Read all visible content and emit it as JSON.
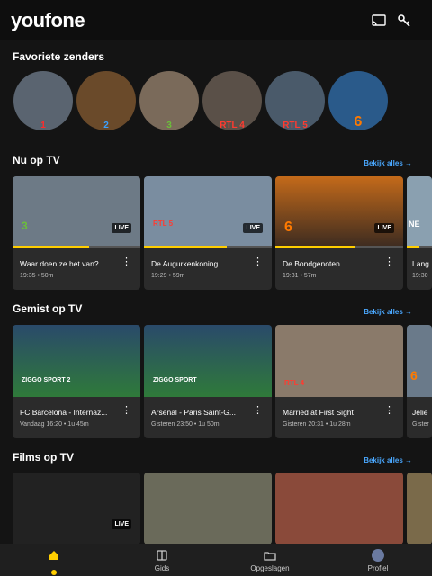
{
  "app": {
    "logo": "youfone"
  },
  "icons": {
    "cast": "cast-icon",
    "key": "key-icon"
  },
  "sections": {
    "favorites": {
      "title": "Favoriete zenders"
    },
    "now": {
      "title": "Nu op TV",
      "see_all": "Bekijk alles →"
    },
    "missed": {
      "title": "Gemist op TV",
      "see_all": "Bekijk alles →"
    },
    "films": {
      "title": "Films op TV",
      "see_all": "Bekijk alles →"
    }
  },
  "channels": [
    {
      "badge": "1",
      "color": "#ff2b2b"
    },
    {
      "badge": "2",
      "color": "#3aa0ff"
    },
    {
      "badge": "3",
      "color": "#6bbf3a"
    },
    {
      "badge": "RTL 4",
      "color": "#ff3b30"
    },
    {
      "badge": "RTL 5",
      "color": "#ff3b30"
    },
    {
      "badge": "6",
      "color": "#ff7a00"
    }
  ],
  "now_cards": [
    {
      "title": "Waar doen ze het van?",
      "meta": "19:35 • 50m",
      "live": "LIVE",
      "logo": "3",
      "progress": 0.6
    },
    {
      "title": "De Augurkenkoning",
      "meta": "19:29 • 59m",
      "live": "LIVE",
      "logo": "RTL 5",
      "progress": 0.65
    },
    {
      "title": "De Bondgenoten",
      "meta": "19:31 • 57m",
      "live": "LIVE",
      "logo": "6",
      "progress": 0.62
    },
    {
      "title": "Lang",
      "meta": "19:30",
      "live": "",
      "logo": "NE",
      "progress": 0.5
    }
  ],
  "missed_cards": [
    {
      "title": "FC Barcelona - Internaz...",
      "meta": "Vandaag 16:20 • 1u 45m",
      "logo": "ZIGGO SPORT 2"
    },
    {
      "title": "Arsenal - Paris Saint-G...",
      "meta": "Gisteren 23:50 • 1u 50m",
      "logo": "ZIGGO SPORT"
    },
    {
      "title": "Married at First Sight",
      "meta": "Gisteren 20:31 • 1u 28m",
      "logo": "RTL 4"
    },
    {
      "title": "Jelie",
      "meta": "Gister",
      "logo": "6"
    }
  ],
  "film_cards": [
    {
      "live": "LIVE"
    },
    {
      "live": ""
    },
    {
      "live": ""
    },
    {
      "live": ""
    }
  ],
  "nav": [
    {
      "label": ""
    },
    {
      "label": "Gids"
    },
    {
      "label": "Opgeslagen"
    },
    {
      "label": "Profiel"
    }
  ]
}
